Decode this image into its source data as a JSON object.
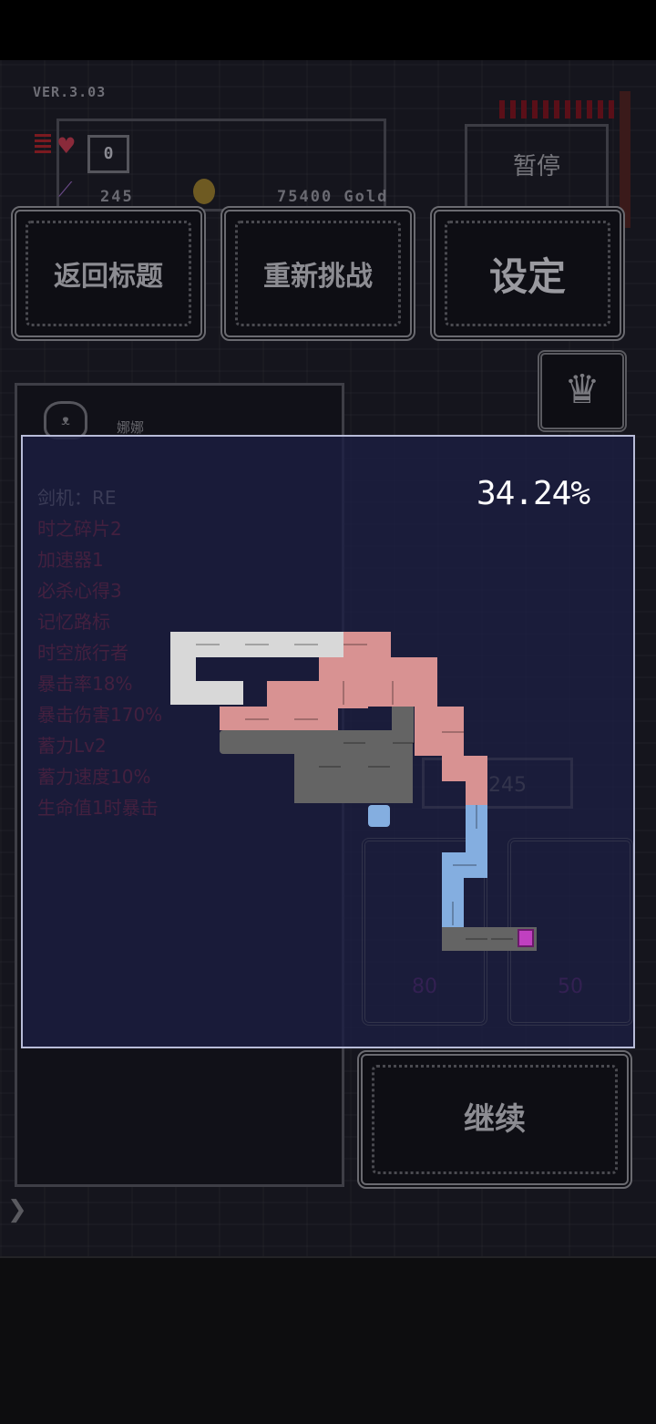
{
  "hud": {
    "version": "VER.3.03",
    "death_count": "0",
    "power": "245",
    "gold": "75400 Gold",
    "pause_label": "暂停",
    "heart_icon": "heart-icon",
    "sword_icon": "sword-icon",
    "coin_icon": "coin-icon"
  },
  "menu": {
    "return_title_label": "返回标题",
    "retry_label": "重新挑战",
    "settings_label": "设定",
    "crown_icon": "crown-icon"
  },
  "character": {
    "name": "娜娜",
    "avatar_icon": "cat-avatar-icon"
  },
  "stats_behind": [
    "",
    "剑机：RE",
    "时之碎片2",
    "加速器1",
    "必杀心得3",
    "记忆路标",
    "时空旅行者",
    "",
    "暴击率18%",
    "暴击伤害170%",
    "蓄力Lv2",
    "蓄力速度10%",
    "生命值1时暴击"
  ],
  "ghost_value": "245",
  "ghost_cards": [
    "80",
    "50"
  ],
  "continue_label": "继续",
  "map": {
    "progress": "34.24%",
    "colors": {
      "white_room": "#d8d8d8",
      "pink_room": "#d89292",
      "gray_room": "#646464",
      "blue_room": "#84aee0",
      "current_marker": "#c040c0",
      "overlay_border": "#b8bcd8"
    },
    "explored_fraction": 0.3424
  }
}
